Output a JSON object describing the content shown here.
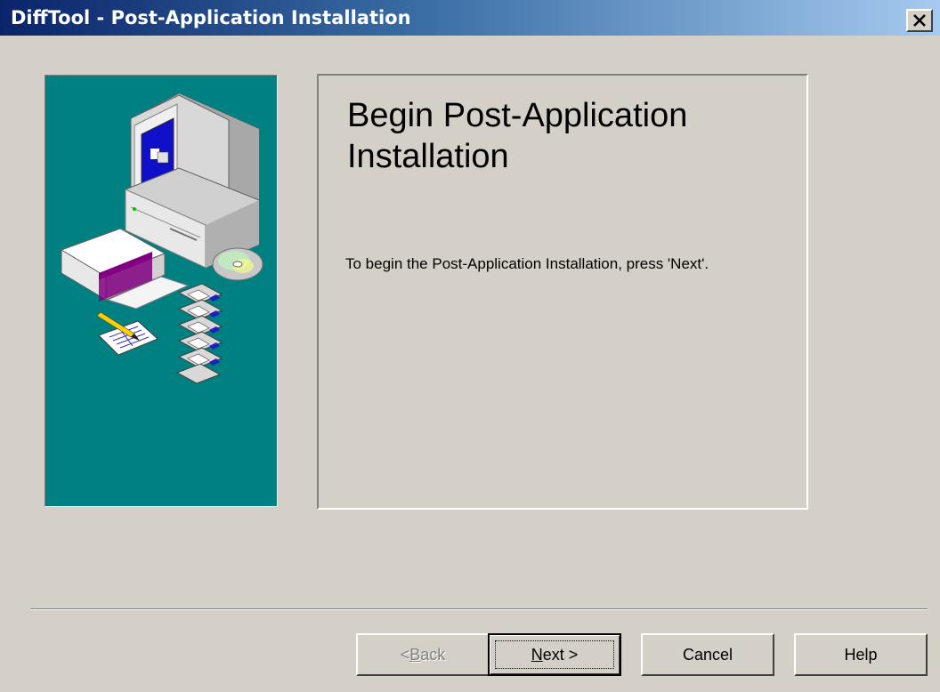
{
  "window": {
    "title": "DiffTool - Post-Application Installation"
  },
  "content": {
    "heading": "Begin Post-Application Installation",
    "body": "To begin the Post-Application Installation, press 'Next'."
  },
  "buttons": {
    "back": {
      "pre": "< ",
      "mnemonic": "B",
      "rest": "ack",
      "enabled": false
    },
    "next": {
      "mnemonic": "N",
      "rest": "ext >",
      "default": true
    },
    "cancel": "Cancel",
    "help": "Help"
  },
  "colors": {
    "dialog_bg": "#d4d0c8",
    "banner_bg": "#008080",
    "titlebar_start": "#0a246a",
    "titlebar_end": "#a6caf0"
  },
  "icons": [
    "close-icon",
    "computer-illustration",
    "cd-icon",
    "floppy-disk-icon",
    "software-box-icon",
    "notepad-pencil-icon"
  ]
}
